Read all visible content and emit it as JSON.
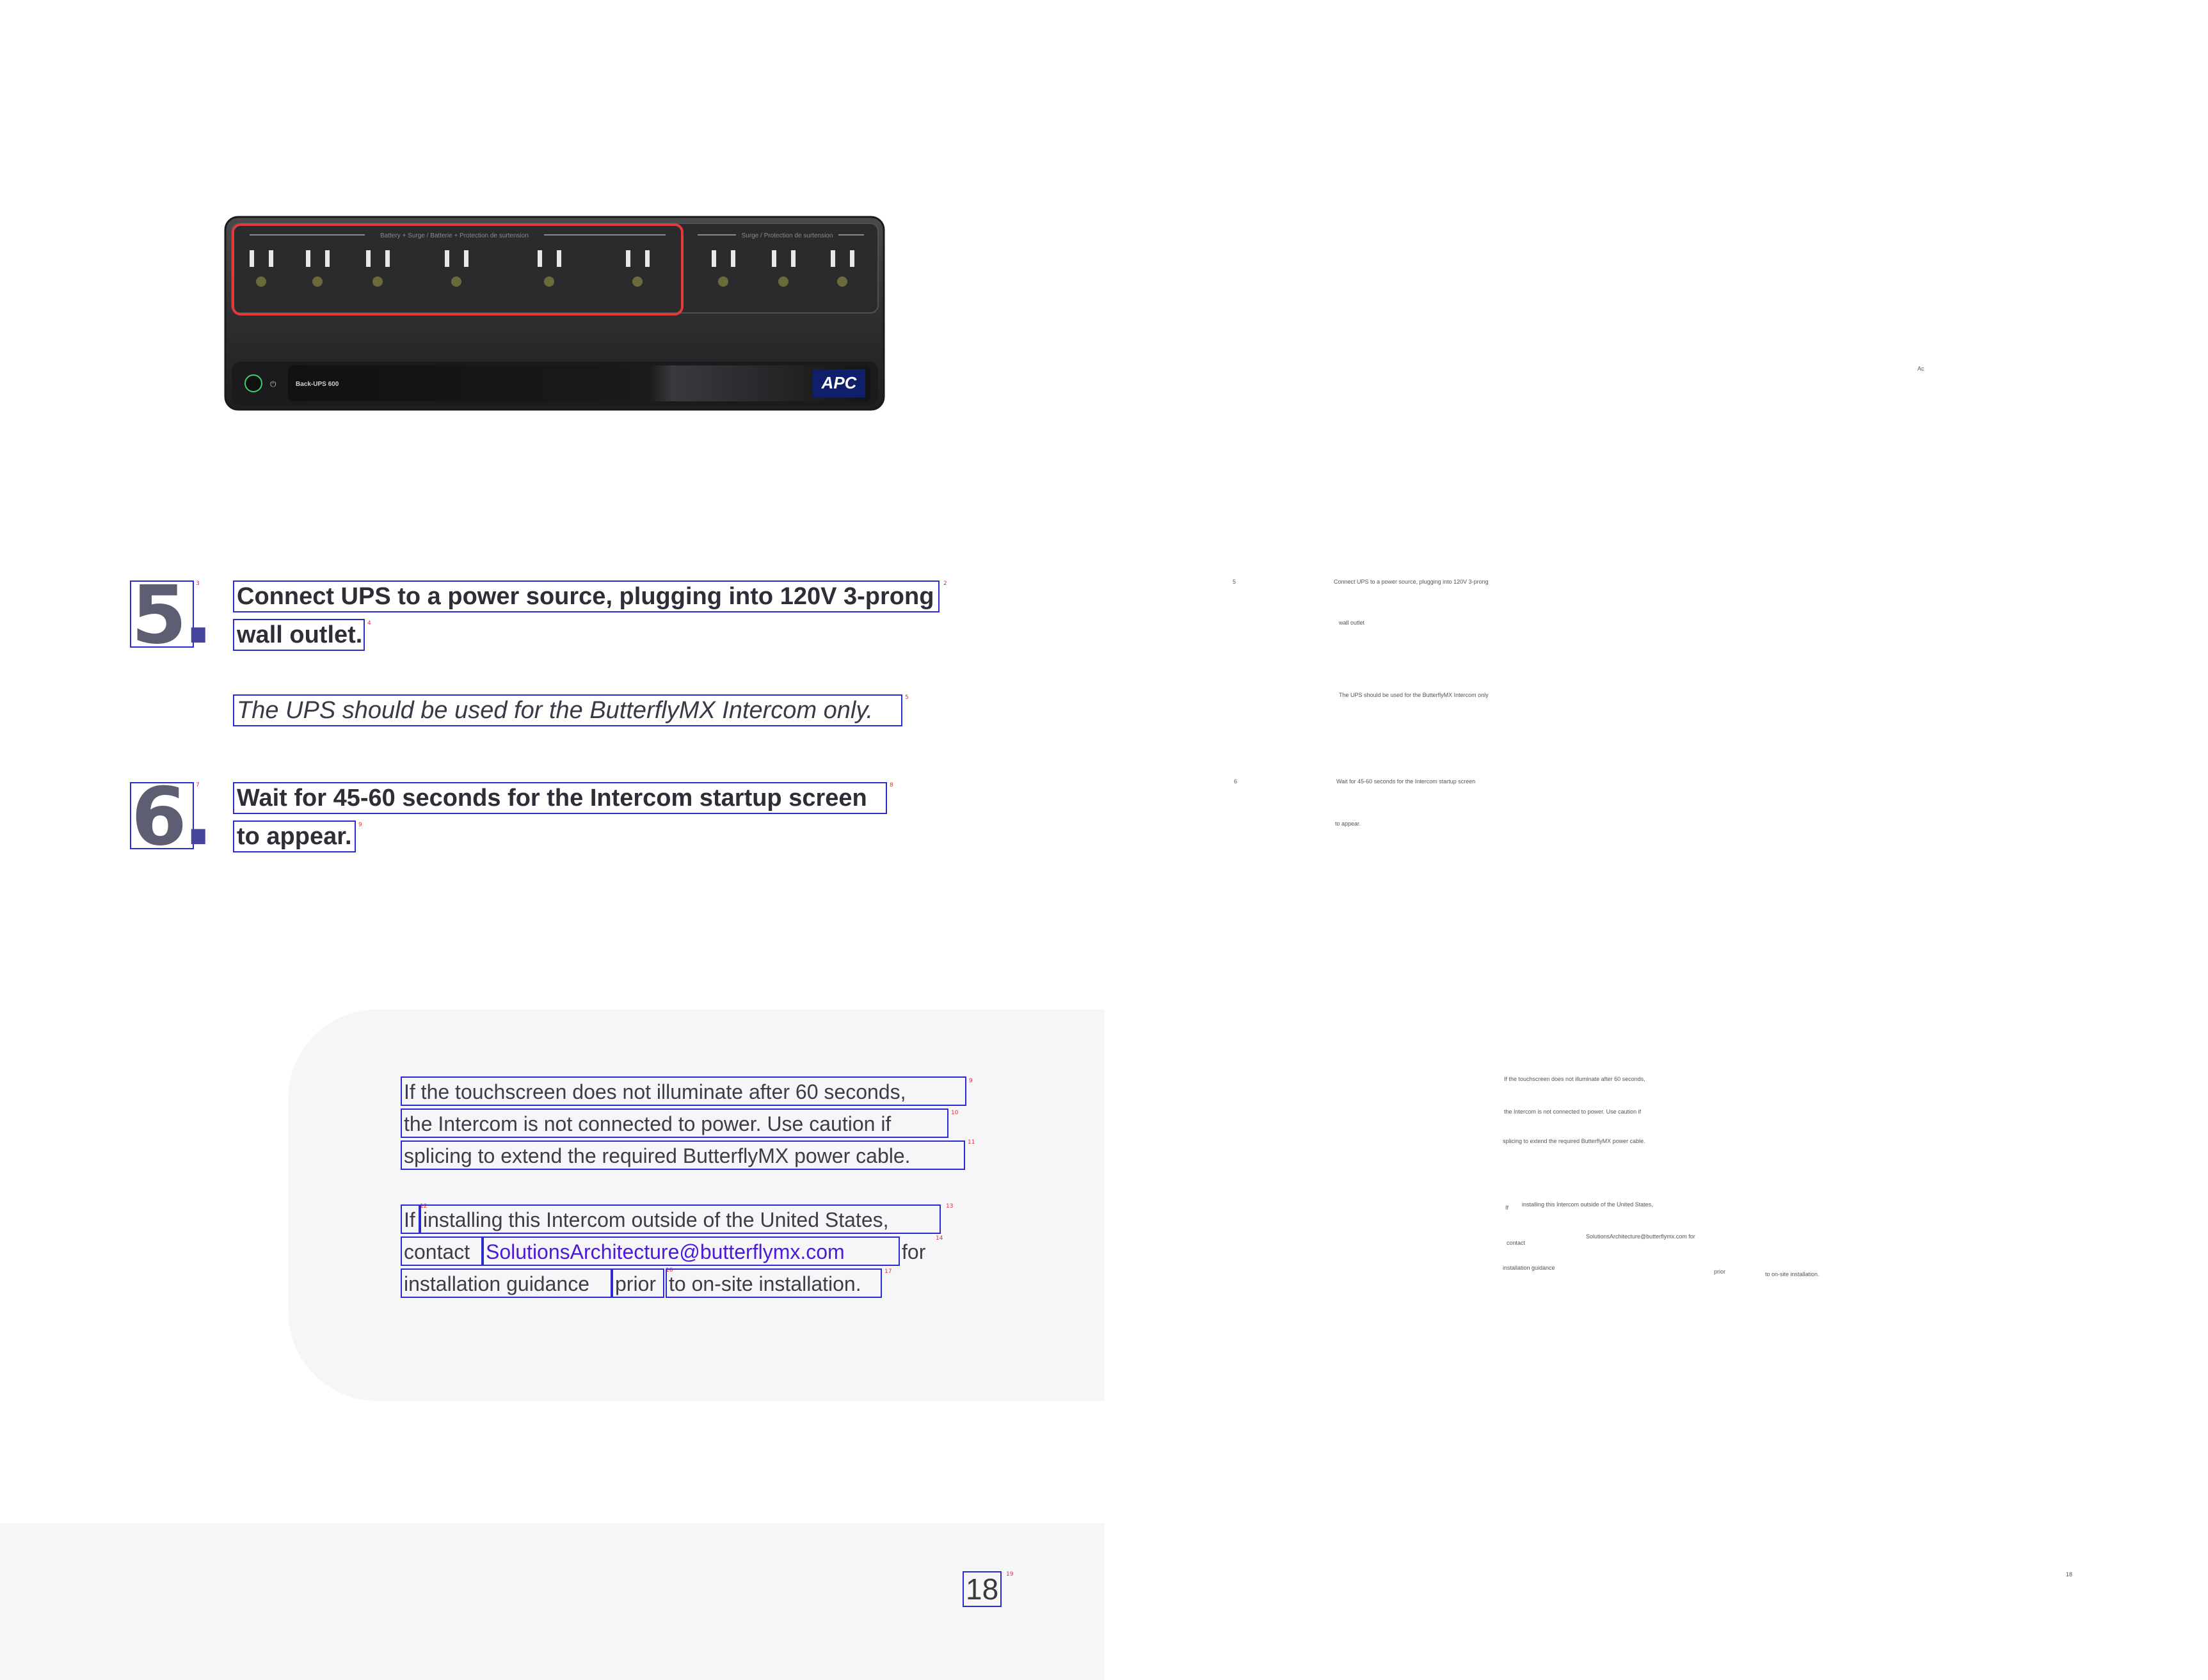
{
  "product_image": {
    "brand": "APC",
    "model_label": "Back-UPS 600",
    "bank_left_label": "Battery + Surge / Batterie + Protection de surtension",
    "bank_right_label": "Surge / Protection de surtension",
    "highlight_color": "#e03a3a"
  },
  "steps": [
    {
      "number": "5",
      "line1": "Connect UPS to a power source, plugging into 120V 3-prong",
      "line2": "wall outlet."
    },
    {
      "number": "6",
      "line1": "Wait for 45-60 seconds for the Intercom startup screen",
      "line2": "to appear."
    }
  ],
  "note": "The UPS should be used for the ButterflyMX Intercom only.",
  "callout": {
    "p1": [
      "If the touchscreen does not illuminate after 60 seconds,",
      "the Intercom is not connected to power. Use caution if",
      "splicing to extend the required ButterflyMX power cable."
    ],
    "p2": {
      "if": "If",
      "line1": "installing this Intercom outside of the United States,",
      "contact": "contact",
      "email": "SolutionsArchitecture@butterflymx.com",
      "for": "for",
      "guidance": "installation guidance",
      "prior": "prior",
      "rest": "to on-site installation."
    }
  },
  "page_number": "18",
  "markers": [
    "1",
    "2",
    "3",
    "4",
    "5",
    "6",
    "7",
    "8",
    "9",
    "10",
    "11",
    "12",
    "13",
    "14",
    "15",
    "16",
    "17",
    "18",
    "19"
  ],
  "ghost": {
    "ac": "Ac",
    "s5": "5",
    "s5l1": "Connect UPS to a power source, plugging into 120V 3-prong",
    "s5l2": "wall outlet",
    "note": "The UPS should be used for the ButterflyMX Intercom only",
    "s6": "6",
    "s6l1": "Wait for 45-60 seconds for the Intercom startup screen",
    "s6l2": "to appear.",
    "c1": "If the touchscreen does not illuminate after 60 seconds,",
    "c2": "the Intercom is not connected to power. Use caution if",
    "c3": "splicing to extend the required ButterflyMX power cable.",
    "c4a": "If",
    "c4b": "installing this Intercom outside of the United States,",
    "c5a": "contact",
    "c5b": "SolutionsArchitecture@butterflymx.com for",
    "c6a": "installation guidance",
    "c6b": "prior",
    "c6c": "to on-site installation.",
    "page": "18"
  }
}
